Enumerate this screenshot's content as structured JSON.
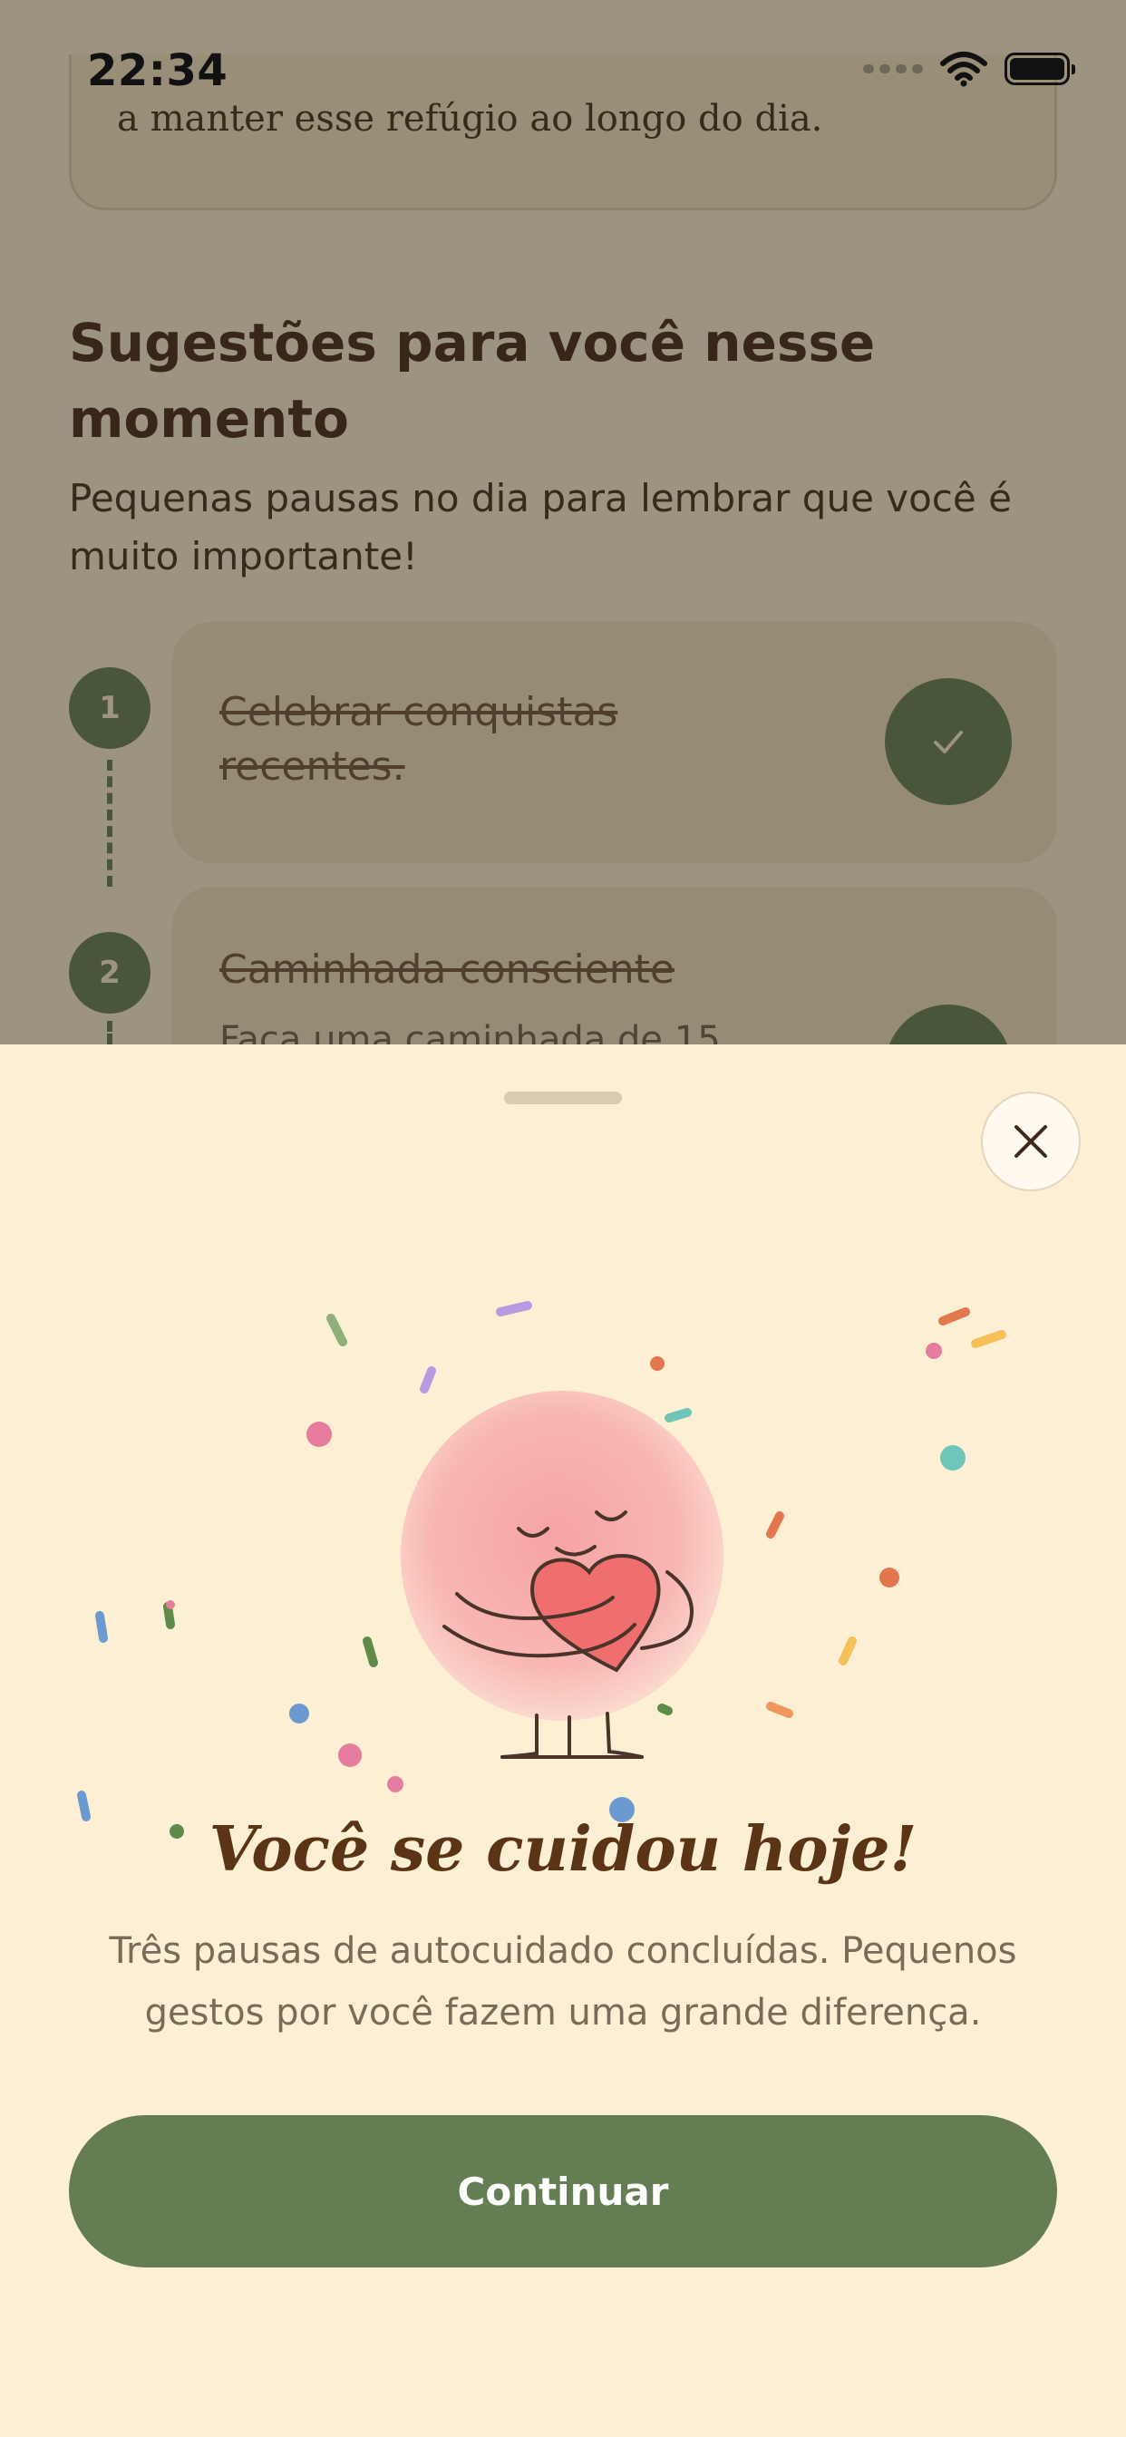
{
  "status_bar": {
    "time": "22:34"
  },
  "background": {
    "top_card_partial_text": "a manter esse refúgio ao longo do dia.",
    "section_title": "Sugestões para você nesse momento",
    "section_subtitle": "Pequenas pausas no dia para lembrar que você é muito importante!",
    "tasks": [
      {
        "number": "1",
        "title": "Celebrar conquistas recentes.",
        "description": "",
        "completed": true
      },
      {
        "number": "2",
        "title": "Caminhada consciente",
        "description": "Faça uma caminhada de 15...",
        "completed": true
      }
    ]
  },
  "sheet": {
    "title": "Você se cuidou hoje!",
    "description": "Três pausas de autocuidado concluídas. Pequenos gestos por você fazem uma grande diferença.",
    "continue_label": "Continuar"
  },
  "colors": {
    "accent_green": "#657d53",
    "sheet_background": "#fdefd4",
    "title_brown": "#5a3415",
    "mascot_pink": "#f5a8a8",
    "heart_red": "#ef6f6f"
  },
  "icons": [
    "wifi-icon",
    "battery-icon",
    "cellular-signal-icon",
    "check-icon",
    "close-icon",
    "hugging-heart-mascot",
    "confetti"
  ]
}
